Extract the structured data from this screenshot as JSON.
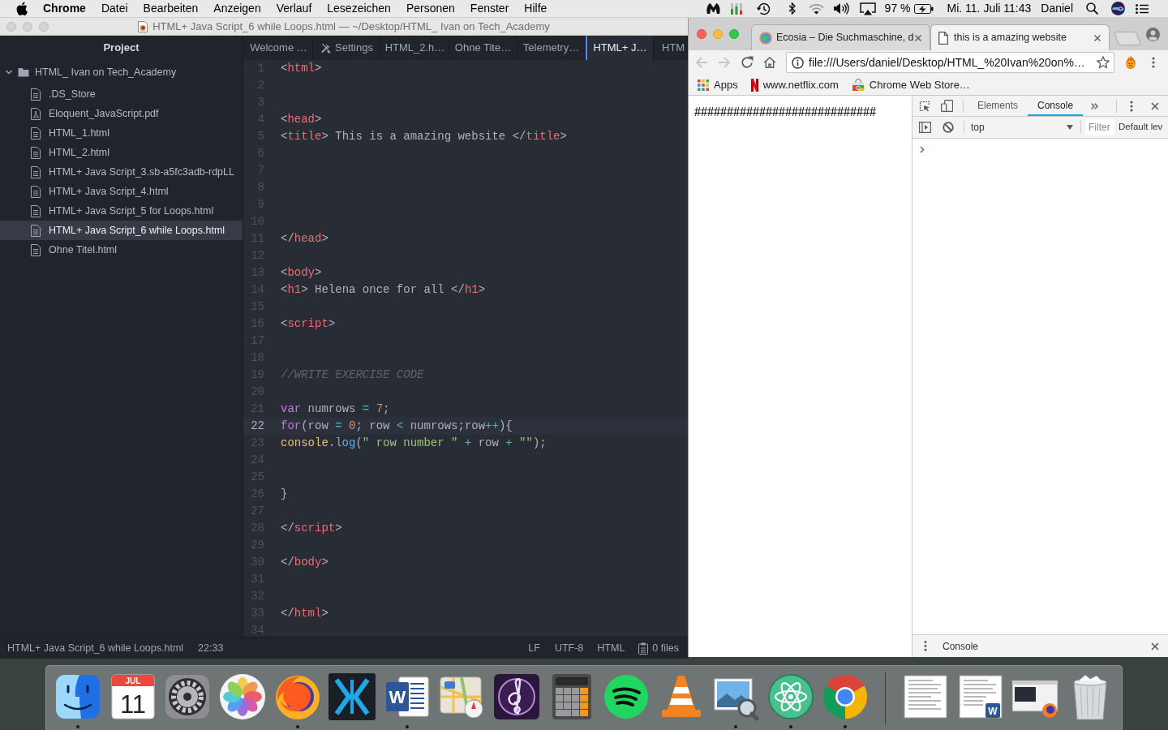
{
  "menu_bar": {
    "app": "Chrome",
    "menus": [
      "Datei",
      "Bearbeiten",
      "Anzeigen",
      "Verlauf",
      "Lesezeichen",
      "Personen",
      "Fenster",
      "Hilfe"
    ],
    "battery": "97 %",
    "clock": "Mi. 11. Juli 11:43",
    "user": "Daniel"
  },
  "editor_window": {
    "title": "HTML+ Java Script_6 while Loops.html — ~/Desktop/HTML_ Ivan on Tech_Academy",
    "sidebar": {
      "header": "Project",
      "tree": [
        {
          "label": "HTML_ Ivan on Tech_Academy",
          "kind": "folder",
          "expanded": true,
          "selected": false,
          "children": [
            {
              "label": ".DS_Store",
              "kind": "file",
              "selected": false
            },
            {
              "label": "Eloquent_JavaScript.pdf",
              "kind": "pdf",
              "selected": false
            },
            {
              "label": "HTML_1.html",
              "kind": "file",
              "selected": false
            },
            {
              "label": "HTML_2.html",
              "kind": "file",
              "selected": false
            },
            {
              "label": "HTML+ Java Script_3.sb-a5fc3adb-rdpLL",
              "kind": "file",
              "selected": false
            },
            {
              "label": "HTML+ Java Script_4.html",
              "kind": "file",
              "selected": false
            },
            {
              "label": "HTML+ Java Script_5 for Loops.html",
              "kind": "file",
              "selected": false
            },
            {
              "label": "HTML+ Java Script_6 while Loops.html",
              "kind": "file",
              "selected": true
            },
            {
              "label": "Ohne Titel.html",
              "kind": "file",
              "selected": false
            }
          ]
        }
      ]
    },
    "tabs": [
      {
        "label": "Welcome …",
        "kind": "file",
        "selected": false
      },
      {
        "label": "Settings",
        "kind": "settings",
        "selected": false
      },
      {
        "label": "HTML_2.h…",
        "kind": "file",
        "selected": false
      },
      {
        "label": "Ohne Tite…",
        "kind": "file",
        "selected": false
      },
      {
        "label": "Telemetry…",
        "kind": "file",
        "selected": false
      },
      {
        "label": "HTML+ J…",
        "kind": "file",
        "selected": true
      },
      {
        "label": "HTM",
        "kind": "file",
        "selected": false
      }
    ],
    "lines": [
      {
        "number": "1",
        "current": false,
        "tokens": [
          {
            "kind": "punct",
            "text": "<"
          },
          {
            "kind": "tag",
            "text": "html"
          },
          {
            "kind": "punct",
            "text": ">"
          }
        ]
      },
      {
        "number": "2",
        "current": false
      },
      {
        "number": "3",
        "current": false
      },
      {
        "number": "4",
        "current": false,
        "tokens": [
          {
            "kind": "punct",
            "text": "<"
          },
          {
            "kind": "tag",
            "text": "head"
          },
          {
            "kind": "punct",
            "text": ">"
          }
        ]
      },
      {
        "number": "5",
        "current": false,
        "tokens": [
          {
            "kind": "punct",
            "text": "<"
          },
          {
            "kind": "tag",
            "text": "title"
          },
          {
            "kind": "punct",
            "text": ">"
          },
          {
            "kind": "text",
            "text": " This is a amazing website "
          },
          {
            "kind": "punct",
            "text": "</"
          },
          {
            "kind": "tag",
            "text": "title"
          },
          {
            "kind": "punct",
            "text": ">"
          }
        ]
      },
      {
        "number": "6",
        "current": false
      },
      {
        "number": "7",
        "current": false
      },
      {
        "number": "8",
        "current": false
      },
      {
        "number": "9",
        "current": false
      },
      {
        "number": "10",
        "current": false
      },
      {
        "number": "11",
        "current": false,
        "tokens": [
          {
            "kind": "punct",
            "text": "</"
          },
          {
            "kind": "tag",
            "text": "head"
          },
          {
            "kind": "punct",
            "text": ">"
          }
        ]
      },
      {
        "number": "12",
        "current": false
      },
      {
        "number": "13",
        "current": false,
        "tokens": [
          {
            "kind": "punct",
            "text": "<"
          },
          {
            "kind": "tag",
            "text": "body"
          },
          {
            "kind": "punct",
            "text": ">"
          }
        ]
      },
      {
        "number": "14",
        "current": false,
        "tokens": [
          {
            "kind": "punct",
            "text": "<"
          },
          {
            "kind": "tag",
            "text": "h1"
          },
          {
            "kind": "punct",
            "text": ">"
          },
          {
            "kind": "text",
            "text": " Helena once for all "
          },
          {
            "kind": "punct",
            "text": "</"
          },
          {
            "kind": "tag",
            "text": "h1"
          },
          {
            "kind": "punct",
            "text": ">"
          }
        ]
      },
      {
        "number": "15",
        "current": false
      },
      {
        "number": "16",
        "current": false,
        "tokens": [
          {
            "kind": "punct",
            "text": "<"
          },
          {
            "kind": "tag",
            "text": "script"
          },
          {
            "kind": "punct",
            "text": ">"
          }
        ]
      },
      {
        "number": "17",
        "current": false
      },
      {
        "number": "18",
        "current": false
      },
      {
        "number": "19",
        "current": false,
        "tokens": [
          {
            "kind": "comment",
            "text": "//WRITE EXERCISE CODE"
          }
        ]
      },
      {
        "number": "20",
        "current": false
      },
      {
        "number": "21",
        "current": false,
        "tokens": [
          {
            "kind": "keyword",
            "text": "var"
          },
          {
            "kind": "text",
            "text": " numrows "
          },
          {
            "kind": "operator",
            "text": "= "
          },
          {
            "kind": "number",
            "text": "7"
          },
          {
            "kind": "text",
            "text": ";"
          }
        ]
      },
      {
        "number": "22",
        "current": true,
        "tokens": [
          {
            "kind": "keyword",
            "text": "for"
          },
          {
            "kind": "text",
            "text": "(row "
          },
          {
            "kind": "operator",
            "text": "= "
          },
          {
            "kind": "number",
            "text": "0"
          },
          {
            "kind": "text",
            "text": "; row "
          },
          {
            "kind": "operator",
            "text": "<"
          },
          {
            "kind": "text",
            "text": " numrows;row"
          },
          {
            "kind": "operator",
            "text": "++"
          },
          {
            "kind": "text",
            "text": "){"
          }
        ]
      },
      {
        "number": "23",
        "current": false,
        "tokens": [
          {
            "kind": "support",
            "text": "console"
          },
          {
            "kind": "text",
            "text": "."
          },
          {
            "kind": "function",
            "text": "log"
          },
          {
            "kind": "text",
            "text": "("
          },
          {
            "kind": "string",
            "text": "\" row number \""
          },
          {
            "kind": "operator",
            "text": " + "
          },
          {
            "kind": "text",
            "text": "row "
          },
          {
            "kind": "operator",
            "text": "+ "
          },
          {
            "kind": "string",
            "text": "\"\""
          },
          {
            "kind": "text",
            "text": ");"
          }
        ]
      },
      {
        "number": "24",
        "current": false
      },
      {
        "number": "25",
        "current": false
      },
      {
        "number": "26",
        "current": false,
        "tokens": [
          {
            "kind": "text",
            "text": "}"
          }
        ]
      },
      {
        "number": "27",
        "current": false
      },
      {
        "number": "28",
        "current": false,
        "tokens": [
          {
            "kind": "punct",
            "text": "</"
          },
          {
            "kind": "tag",
            "text": "script"
          },
          {
            "kind": "punct",
            "text": ">"
          }
        ]
      },
      {
        "number": "29",
        "current": false
      },
      {
        "number": "30",
        "current": false,
        "tokens": [
          {
            "kind": "punct",
            "text": "</"
          },
          {
            "kind": "tag",
            "text": "body"
          },
          {
            "kind": "punct",
            "text": ">"
          }
        ]
      },
      {
        "number": "31",
        "current": false
      },
      {
        "number": "32",
        "current": false
      },
      {
        "number": "33",
        "current": false,
        "tokens": [
          {
            "kind": "punct",
            "text": "</"
          },
          {
            "kind": "tag",
            "text": "html"
          },
          {
            "kind": "punct",
            "text": ">"
          }
        ]
      },
      {
        "number": "34",
        "current": false
      }
    ],
    "status_bar": {
      "file": "HTML+ Java Script_6 while Loops.html",
      "cursor": "22:33",
      "line_ending": "LF",
      "encoding": "UTF-8",
      "grammar": "HTML",
      "files": "0 files"
    }
  },
  "browser_window": {
    "tabs": [
      {
        "title": "Ecosia – Die Suchmaschine, d",
        "kind": "globe",
        "selected": false
      },
      {
        "title": "this is a amazing website",
        "kind": "page",
        "selected": true
      }
    ],
    "navigation": {
      "back_disabled": true,
      "forward_disabled": true
    },
    "url": "file:///Users/daniel/Desktop/HTML_%20Ivan%20on%…",
    "bookmarks": [
      {
        "label": "Apps",
        "kind": "apps"
      },
      {
        "label": "www.netflix.com",
        "kind": "ribbon"
      },
      {
        "label": "Chrome Web Store…",
        "kind": "store"
      }
    ],
    "page_text": "############################",
    "devtools": {
      "tabs": [
        {
          "label": "Elements",
          "selected": false
        },
        {
          "label": "Console",
          "selected": true
        }
      ],
      "context": "top",
      "filter_placeholder": "Filter",
      "levels": "Default lev",
      "drawer_tab": "Console"
    }
  },
  "dock": {
    "apps": [
      {
        "kind": "finder",
        "running": true
      },
      {
        "kind": "calendar",
        "month": "JUL",
        "day": "11",
        "running": false
      },
      {
        "kind": "gear",
        "running": false
      },
      {
        "kind": "petals",
        "running": false
      },
      {
        "kind": "fox",
        "running": true
      },
      {
        "kind": "chevrons",
        "running": false
      },
      {
        "kind": "word",
        "letter": "W",
        "running": true
      },
      {
        "kind": "map",
        "running": false
      },
      {
        "kind": "clef",
        "running": false
      },
      {
        "kind": "calculator",
        "running": false
      },
      {
        "kind": "waves",
        "running": false
      },
      {
        "kind": "cone",
        "running": false
      },
      {
        "kind": "viewer",
        "running": true
      },
      {
        "kind": "atom",
        "running": true
      },
      {
        "kind": "chrome",
        "running": true
      }
    ],
    "after_divider": [
      {
        "kind": "page"
      },
      {
        "kind": "page_badge",
        "badge": "W"
      },
      {
        "kind": "window"
      },
      {
        "kind": "trash"
      }
    ]
  }
}
